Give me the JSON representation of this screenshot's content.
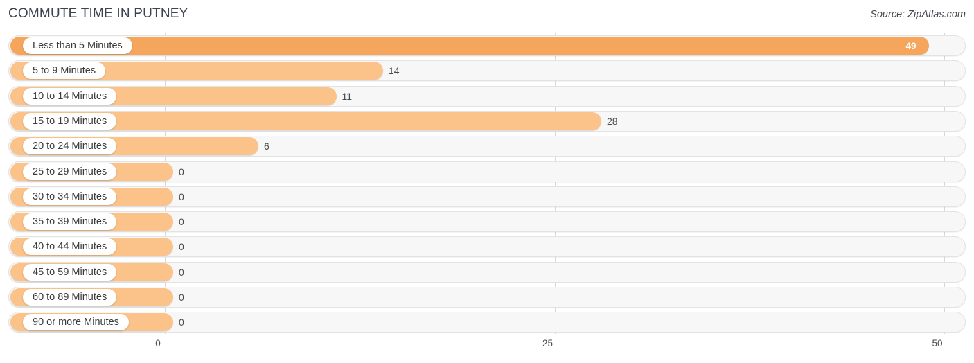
{
  "header": {
    "title": "COMMUTE TIME IN PUTNEY",
    "source": "Source: ZipAtlas.com"
  },
  "colors": {
    "bar": "#fbc289",
    "bar_highlight": "#f5a65c",
    "track": "#f7f7f7",
    "track_border": "#e3e3e3",
    "gridline": "#d8d8d8",
    "label_text": "#3b3b3b",
    "title_text": "#3c4250"
  },
  "chart_data": {
    "type": "bar",
    "orientation": "horizontal",
    "title": "COMMUTE TIME IN PUTNEY",
    "xlabel": "",
    "ylabel": "",
    "xlim": [
      0,
      50
    ],
    "ticks": [
      "0",
      "25",
      "50"
    ],
    "tick_values": [
      0,
      25,
      50
    ],
    "grid": true,
    "legend": false,
    "categories": [
      "Less than 5 Minutes",
      "5 to 9 Minutes",
      "10 to 14 Minutes",
      "15 to 19 Minutes",
      "20 to 24 Minutes",
      "25 to 29 Minutes",
      "30 to 34 Minutes",
      "35 to 39 Minutes",
      "40 to 44 Minutes",
      "45 to 59 Minutes",
      "60 to 89 Minutes",
      "90 or more Minutes"
    ],
    "values": [
      49,
      14,
      11,
      28,
      6,
      0,
      0,
      0,
      0,
      0,
      0,
      0
    ],
    "value_labels": [
      "49",
      "14",
      "11",
      "28",
      "6",
      "0",
      "0",
      "0",
      "0",
      "0",
      "0",
      "0"
    ],
    "highlight_index": 0
  }
}
